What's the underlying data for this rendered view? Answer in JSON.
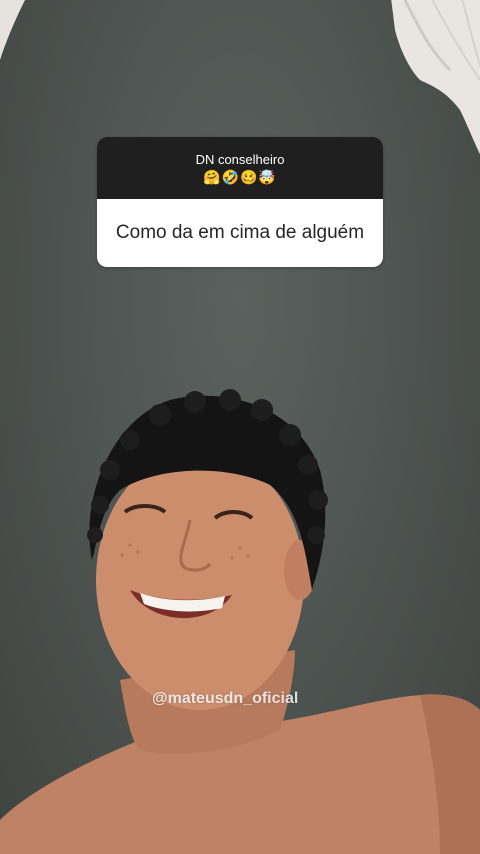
{
  "story": {
    "question_sticker": {
      "title": "DN conselheiro",
      "emojis": "🤗🤣🥴🤯",
      "question": "Como da em cima de alguém"
    },
    "watermark": "@mateusdn_oficial"
  },
  "colors": {
    "background": "#4f5552",
    "sticker_header": "#1f1f1f",
    "sticker_body": "#ffffff",
    "skin": "#c98a6a",
    "hair": "#141414"
  }
}
